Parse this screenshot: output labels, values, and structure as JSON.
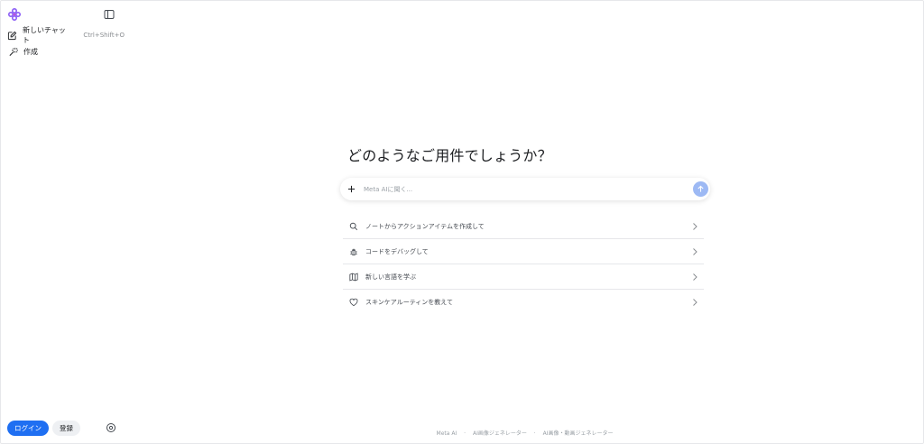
{
  "sidebar": {
    "new_chat_label": "新しいチャット",
    "new_chat_shortcut": "Ctrl+Shift+O",
    "create_label": "作成",
    "login_label": "ログイン",
    "signup_label": "登録"
  },
  "main": {
    "title": "どのようなご用件でしょうか？",
    "ask_placeholder": "Meta AIに聞く...",
    "ask_value": "",
    "suggestions": [
      {
        "icon": "search-icon",
        "label": "ノートからアクションアイテムを作成して"
      },
      {
        "icon": "bug-icon",
        "label": "コードをデバッグして"
      },
      {
        "icon": "map-icon",
        "label": "新しい言語を学ぶ"
      },
      {
        "icon": "heart-icon",
        "label": "スキンケアルーティンを教えて"
      }
    ]
  },
  "footer": {
    "links": [
      "Meta AI",
      "AI画像ジェネレーター",
      "AI画像・動画ジェネレーター"
    ],
    "separator": "·"
  },
  "colors": {
    "accent": "#1f6ff2",
    "send_button": "#9db9f4",
    "logo": "#8a5cf6"
  }
}
